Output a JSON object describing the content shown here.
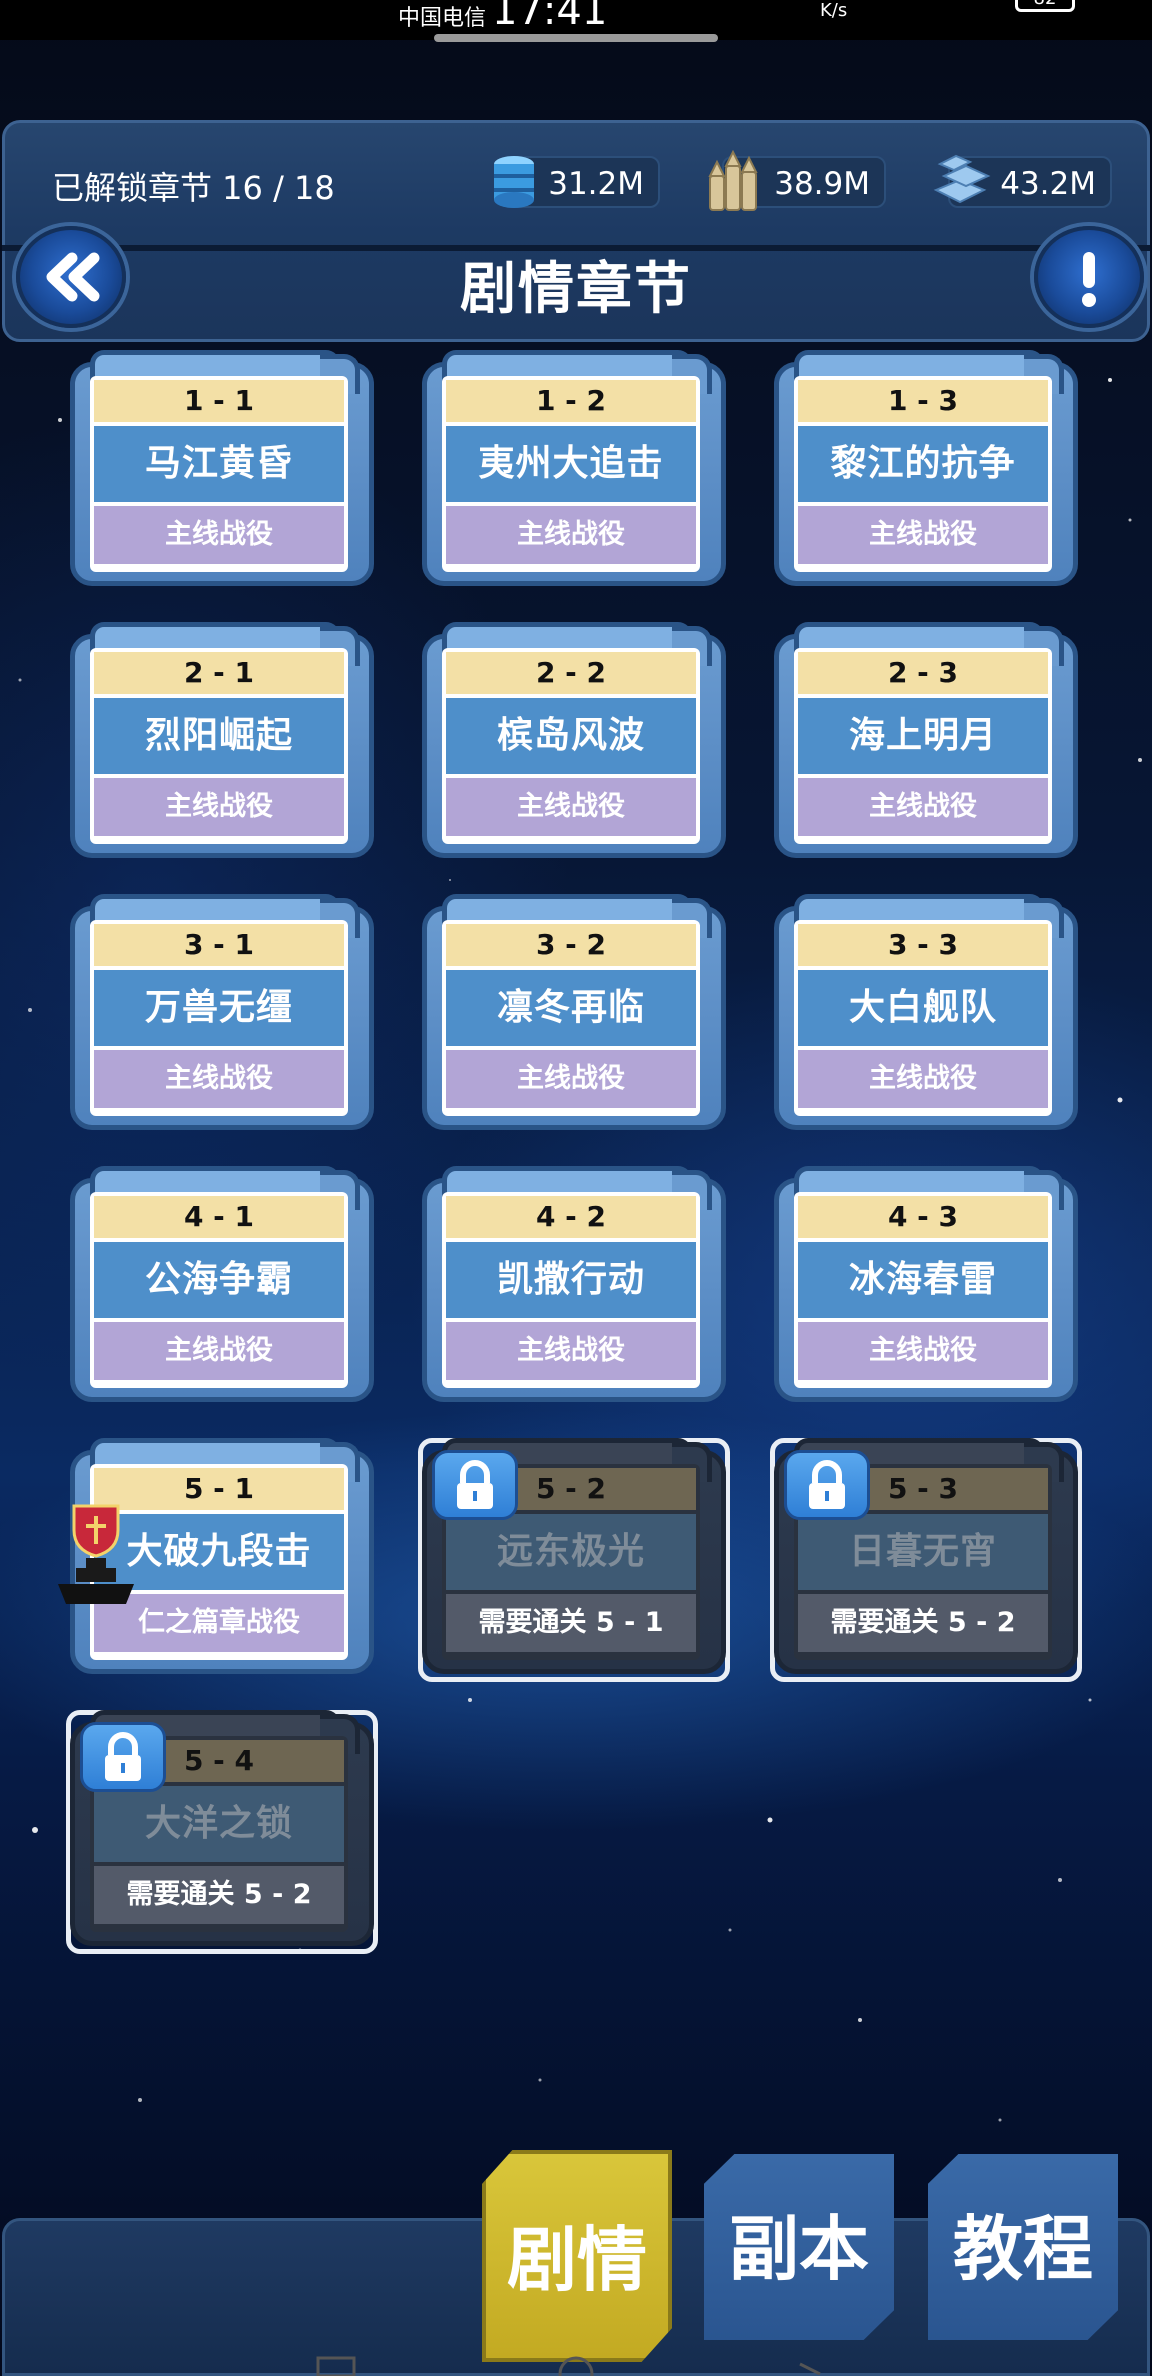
{
  "status_bar": {
    "carrier": "中国电信",
    "time": "17:41",
    "net_speed_unit": "K/s",
    "battery": "82"
  },
  "header": {
    "unlock_label": "已解锁章节 16 / 18",
    "title": "剧情章节",
    "resources": [
      {
        "name": "oil-barrel-icon",
        "value": "31.2M"
      },
      {
        "name": "ammo-shells-icon",
        "value": "38.9M"
      },
      {
        "name": "steel-icon",
        "value": "43.2M"
      }
    ]
  },
  "chapters": [
    {
      "num": "1 - 1",
      "name": "马江黄昏",
      "type": "主线战役",
      "locked": false
    },
    {
      "num": "1 - 2",
      "name": "夷州大追击",
      "type": "主线战役",
      "locked": false
    },
    {
      "num": "1 - 3",
      "name": "黎江的抗争",
      "type": "主线战役",
      "locked": false
    },
    {
      "num": "2 - 1",
      "name": "烈阳崛起",
      "type": "主线战役",
      "locked": false
    },
    {
      "num": "2 - 2",
      "name": "槟岛风波",
      "type": "主线战役",
      "locked": false
    },
    {
      "num": "2 - 3",
      "name": "海上明月",
      "type": "主线战役",
      "locked": false
    },
    {
      "num": "3 - 1",
      "name": "万兽无缰",
      "type": "主线战役",
      "locked": false
    },
    {
      "num": "3 - 2",
      "name": "凛冬再临",
      "type": "主线战役",
      "locked": false
    },
    {
      "num": "3 - 3",
      "name": "大白舰队",
      "type": "主线战役",
      "locked": false
    },
    {
      "num": "4 - 1",
      "name": "公海争霸",
      "type": "主线战役",
      "locked": false
    },
    {
      "num": "4 - 2",
      "name": "凯撒行动",
      "type": "主线战役",
      "locked": false
    },
    {
      "num": "4 - 3",
      "name": "冰海春雷",
      "type": "主线战役",
      "locked": false
    },
    {
      "num": "5 - 1",
      "name": "大破九段击",
      "type": "仁之篇章战役",
      "locked": false,
      "trophy": true
    },
    {
      "num": "5 - 2",
      "name": "远东极光",
      "type": "需要通关 5 - 1",
      "locked": true
    },
    {
      "num": "5 - 3",
      "name": "日暮无宵",
      "type": "需要通关 5 - 2",
      "locked": true
    },
    {
      "num": "5 - 4",
      "name": "大洋之锁",
      "type": "需要通关 5 - 2",
      "locked": true
    }
  ],
  "bottom_nav": {
    "tabs": [
      {
        "label": "剧情",
        "active": true
      },
      {
        "label": "副本",
        "active": false
      },
      {
        "label": "教程",
        "active": false
      }
    ]
  },
  "colors": {
    "card_number_bg": "#f3e0a6",
    "card_name_bg": "#4e8fca",
    "card_type_bg": "#b2a5d6",
    "active_tab": "#d9c63a",
    "panel_bg": "#1d3a63"
  }
}
